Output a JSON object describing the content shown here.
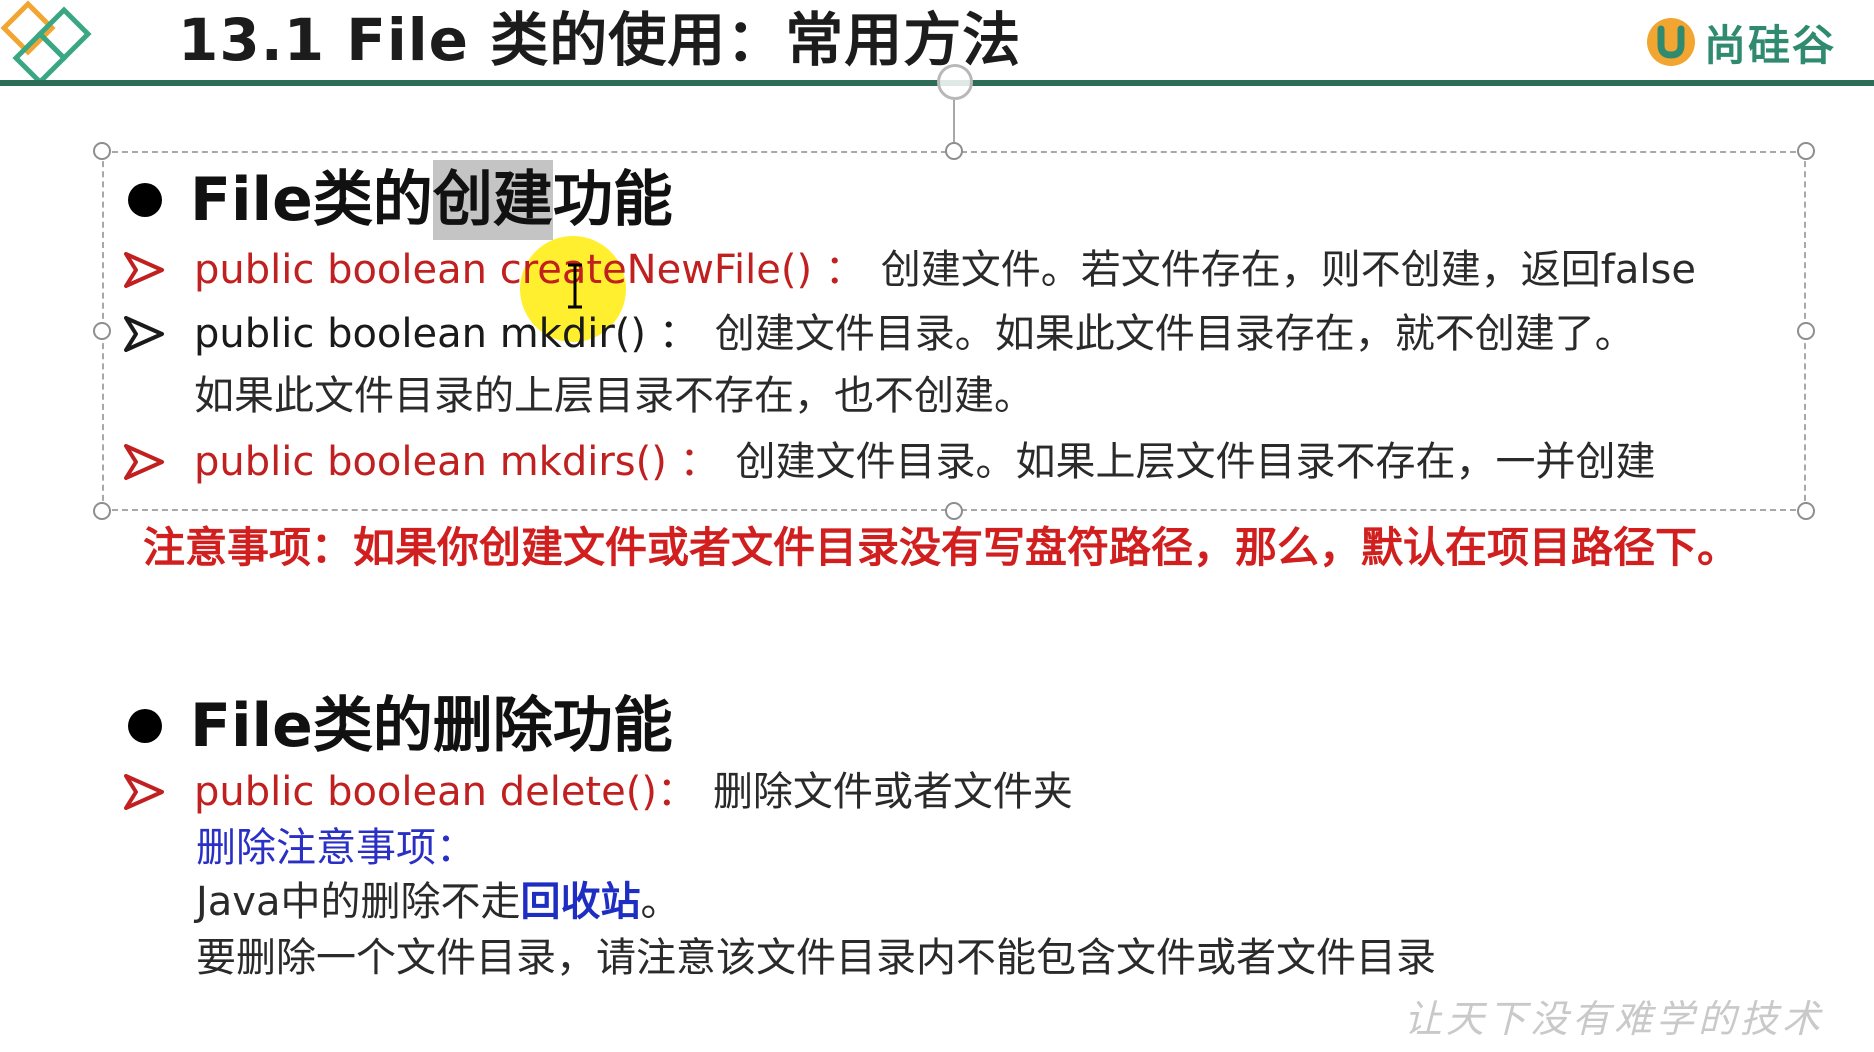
{
  "header": {
    "title": "13.1 File 类的使用：常用方法",
    "brand_name": "尚硅谷",
    "rule_color": "#2d6d58",
    "brand_color": "#2f8a6f"
  },
  "create_section": {
    "heading_prefix": "File类的",
    "heading_highlight": "创建",
    "heading_suffix": "功能",
    "items": [
      {
        "code": "public boolean createNewFile() ：",
        "desc": "创建文件。若文件存在，则不创建，返回false"
      },
      {
        "code": "public boolean  mkdir() ：",
        "desc": "创建文件目录。如果此文件目录存在，就不创建了。",
        "desc_cont": "如果此文件目录的上层目录不存在，也不创建。"
      },
      {
        "code": "public boolean mkdirs() ：",
        "desc": "创建文件目录。如果上层文件目录不存在，一并创建"
      }
    ],
    "note": "注意事项：如果你创建文件或者文件目录没有写盘符路径，那么，默认在项目路径下。"
  },
  "delete_section": {
    "heading": "File类的删除功能",
    "item_code": "public boolean delete()：",
    "item_desc": "删除文件或者文件夹",
    "note_title": "删除注意事项：",
    "line1_prefix": "Java中的删除不走",
    "line1_bold": "回收站",
    "line1_suffix": "。",
    "line2": "要删除一个文件目录，请注意该文件目录内不能包含文件或者文件目录"
  },
  "watermark": "让天下没有难学的技术",
  "colors": {
    "code_red": "#c0201f",
    "note_red": "#d11f1f",
    "note_blue": "#2a2fc6",
    "cursor_highlight": "#ffec00"
  }
}
